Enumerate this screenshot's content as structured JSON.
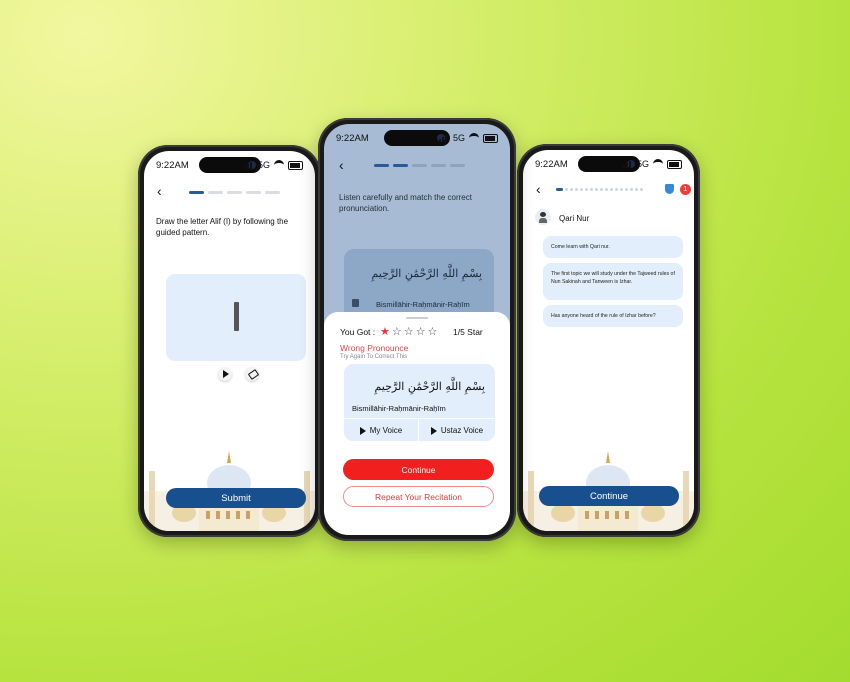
{
  "status": {
    "time": "9:22AM",
    "network": "5G"
  },
  "phone1": {
    "instruction": "Draw the letter Alif (ا) by following the guided pattern.",
    "letter_glyph": "I",
    "submit_label": "Submit"
  },
  "phone2": {
    "instruction": "Listen carefully and match the correct pronunciation.",
    "arabic_verse": "بِسْمِ اللَّهِ الرَّحْمَٰنِ الرَّحِيمِ",
    "transliteration": "Bismillāhir-Raḥmānir-Raḥīm",
    "you_got_label": "You Got :",
    "rating": {
      "stars_filled": 1,
      "stars_total": 5,
      "text": "1/5 Star"
    },
    "result_title": "Wrong Pronounce",
    "result_subtitle": "Try Again To Correct This",
    "my_voice_label": "My Voice",
    "ustaz_voice_label": "Ustaz Voice",
    "continue_label": "Continue",
    "repeat_label": "Repeat Your Recitation"
  },
  "phone3": {
    "teacher_name": "Qari Nur",
    "messages": [
      "Come learn with Qari nur.",
      "The first topic we will study under the Tajweed rules of Nun Sakinah and Tanween is Izhar.",
      "Has anyone heard of the rule of Izhar before?"
    ],
    "badge_count": "1",
    "continue_label": "Continue"
  },
  "colors": {
    "accent_blue": "#184f8e",
    "accent_red": "#f21f1f",
    "card_blue": "#e2eefb",
    "star_red": "#e33"
  }
}
